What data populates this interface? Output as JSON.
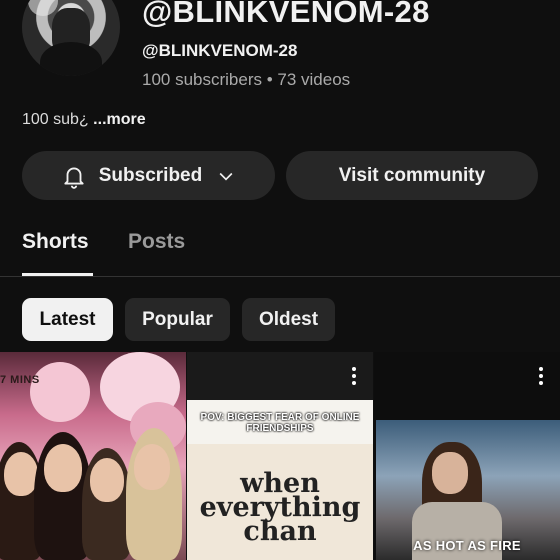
{
  "channel": {
    "title": "@BLINKVENOM-28",
    "handle": "@BLINKVENOM-28",
    "stats": "100 subscribers • 73 videos",
    "about": "100 sub¿",
    "about_more": "...more"
  },
  "actions": {
    "subscribed_label": "Subscribed",
    "community_label": "Visit community"
  },
  "tabs": [
    {
      "label": "Shorts",
      "active": true
    },
    {
      "label": "Posts",
      "active": false
    }
  ],
  "filters": [
    {
      "label": "Latest",
      "selected": true
    },
    {
      "label": "Popular",
      "selected": false
    },
    {
      "label": "Oldest",
      "selected": false
    }
  ],
  "shorts": [
    {
      "caption": "7 MINS",
      "menu_icon": "more-vert-icon"
    },
    {
      "caption_top": "POV: BIGGEST FEAR OF ONLINE FRIENDSHIPS",
      "caption_main": "when everything chan",
      "menu_icon": "more-vert-icon"
    },
    {
      "caption": "AS HOT AS FIRE",
      "menu_icon": "more-vert-icon"
    }
  ],
  "colors": {
    "background": "#0f0f0f",
    "surface": "#272727",
    "text": "#f1f1f1",
    "muted": "#aaaaaa"
  }
}
